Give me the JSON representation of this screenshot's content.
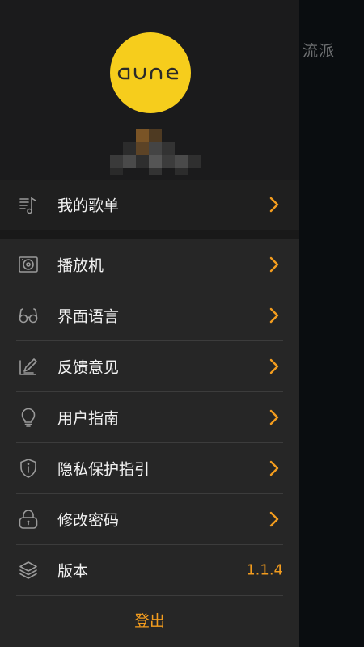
{
  "backdrop": {
    "title": "流派"
  },
  "profile": {
    "logo_text": "aune"
  },
  "playlist": {
    "label": "我的歌单",
    "icon": "music-list-icon"
  },
  "menu": {
    "items": [
      {
        "label": "播放机",
        "icon": "player-icon"
      },
      {
        "label": "界面语言",
        "icon": "glasses-icon"
      },
      {
        "label": "反馈意见",
        "icon": "feedback-edit-icon"
      },
      {
        "label": "用户指南",
        "icon": "lightbulb-icon"
      },
      {
        "label": "隐私保护指引",
        "icon": "shield-info-icon"
      },
      {
        "label": "修改密码",
        "icon": "lock-icon"
      }
    ],
    "version": {
      "label": "版本",
      "value": "1.1.4",
      "icon": "layers-icon"
    }
  },
  "logout": {
    "label": "登出"
  },
  "colors": {
    "accent": "#f39c1e",
    "logo": "#f6cd1c",
    "drawer": "#262626"
  }
}
